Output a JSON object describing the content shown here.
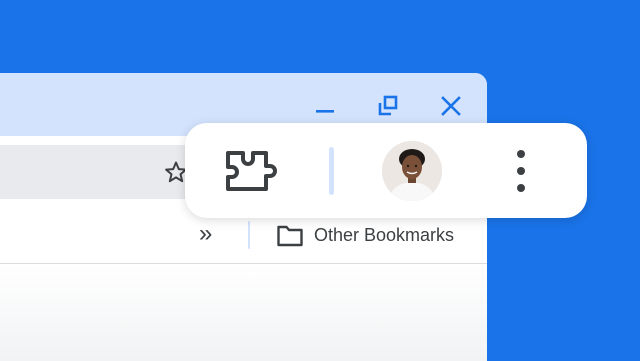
{
  "window": {
    "minimize_icon": "minimize-icon",
    "restore_icon": "restore-icon",
    "close_icon": "close-icon",
    "accent_color": "#1a73e8"
  },
  "toolbar": {
    "bookmark_star_icon": "star-outline-icon"
  },
  "bookmarks_bar": {
    "overflow_glyph": "»",
    "folder_icon": "folder-icon",
    "other_bookmarks_label": "Other Bookmarks"
  },
  "popup": {
    "extensions_icon": "puzzle-piece-icon",
    "profile_avatar": "avatar",
    "menu_icon": "vertical-dots-icon"
  },
  "colors": {
    "background": "#1a73e8",
    "titlebar": "#d3e3fd",
    "icon": "#3c4043",
    "omnibox": "#e8eaed"
  }
}
